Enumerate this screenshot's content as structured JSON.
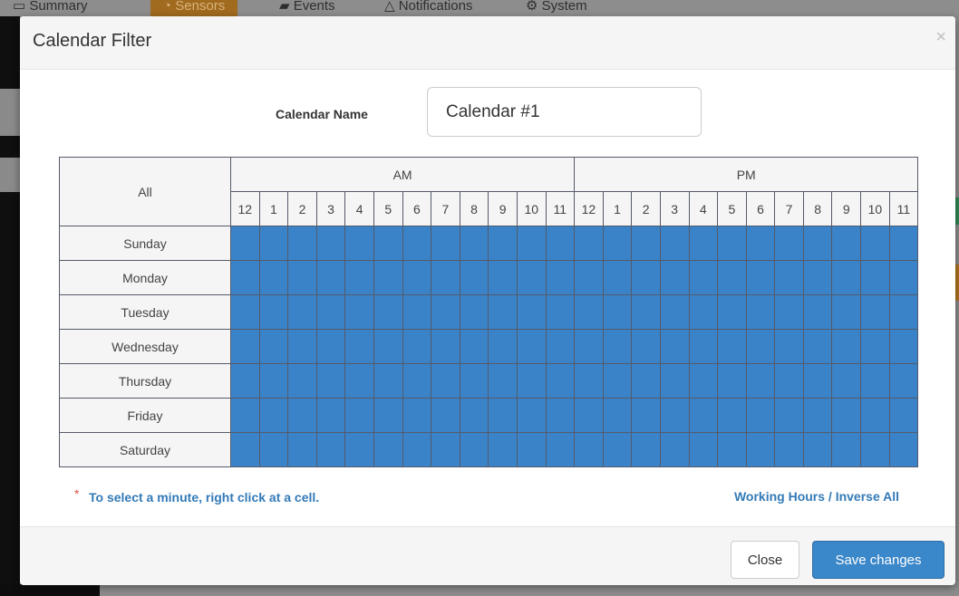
{
  "background_nav": {
    "tabs": [
      {
        "icon": "monitor-icon",
        "label": "Summary"
      },
      {
        "icon": "rss-icon",
        "label": "Sensors",
        "active": true
      },
      {
        "icon": "folder-icon",
        "label": "Events"
      },
      {
        "icon": "warning-icon",
        "label": "Notifications"
      },
      {
        "icon": "cogs-icon",
        "label": "System"
      }
    ]
  },
  "modal": {
    "title": "Calendar Filter",
    "close_symbol": "×",
    "calendar_name_label": "Calendar Name",
    "calendar_name_value": "Calendar #1",
    "schedule": {
      "all_label": "All",
      "am_label": "AM",
      "pm_label": "PM",
      "hours": [
        "12",
        "1",
        "2",
        "3",
        "4",
        "5",
        "6",
        "7",
        "8",
        "9",
        "10",
        "11",
        "12",
        "1",
        "2",
        "3",
        "4",
        "5",
        "6",
        "7",
        "8",
        "9",
        "10",
        "11"
      ],
      "days": [
        "Sunday",
        "Monday",
        "Tuesday",
        "Wednesday",
        "Thursday",
        "Friday",
        "Saturday"
      ],
      "all_slots_selected": true,
      "selected_color": "#3a83c8"
    },
    "note_marker": "*",
    "note_text": "To select a minute, right click at a cell.",
    "right_link": "Working Hours / Inverse All",
    "close_button": "Close",
    "save_button": "Save changes"
  },
  "colors": {
    "primary": "#337ab7",
    "selected_slot": "#3a83c8",
    "note_marker": "#d9534f"
  }
}
